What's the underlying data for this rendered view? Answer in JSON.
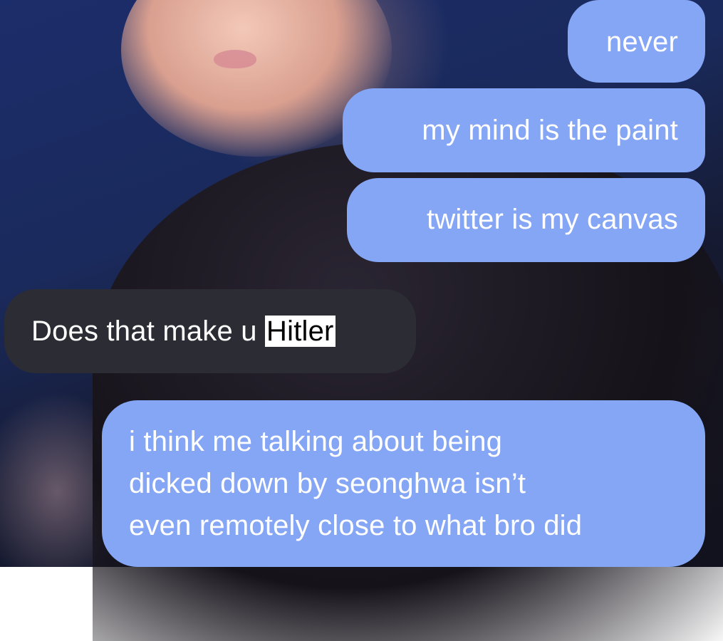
{
  "conversation": {
    "messages": [
      {
        "direction": "outgoing",
        "text": "never"
      },
      {
        "direction": "outgoing",
        "text": "my mind is the paint"
      },
      {
        "direction": "outgoing",
        "text": "twitter is my canvas"
      },
      {
        "direction": "incoming",
        "text_before": "Does that make u ",
        "highlighted": "Hitler"
      },
      {
        "direction": "outgoing",
        "lines": [
          "i think me talking about being",
          "dicked down by seonghwa isn’t",
          "even remotely close to what bro did"
        ]
      }
    ]
  },
  "colors": {
    "outgoing_bubble": "#85a5f5",
    "incoming_bubble": "#2c2c35",
    "highlight": "#ffffff"
  }
}
